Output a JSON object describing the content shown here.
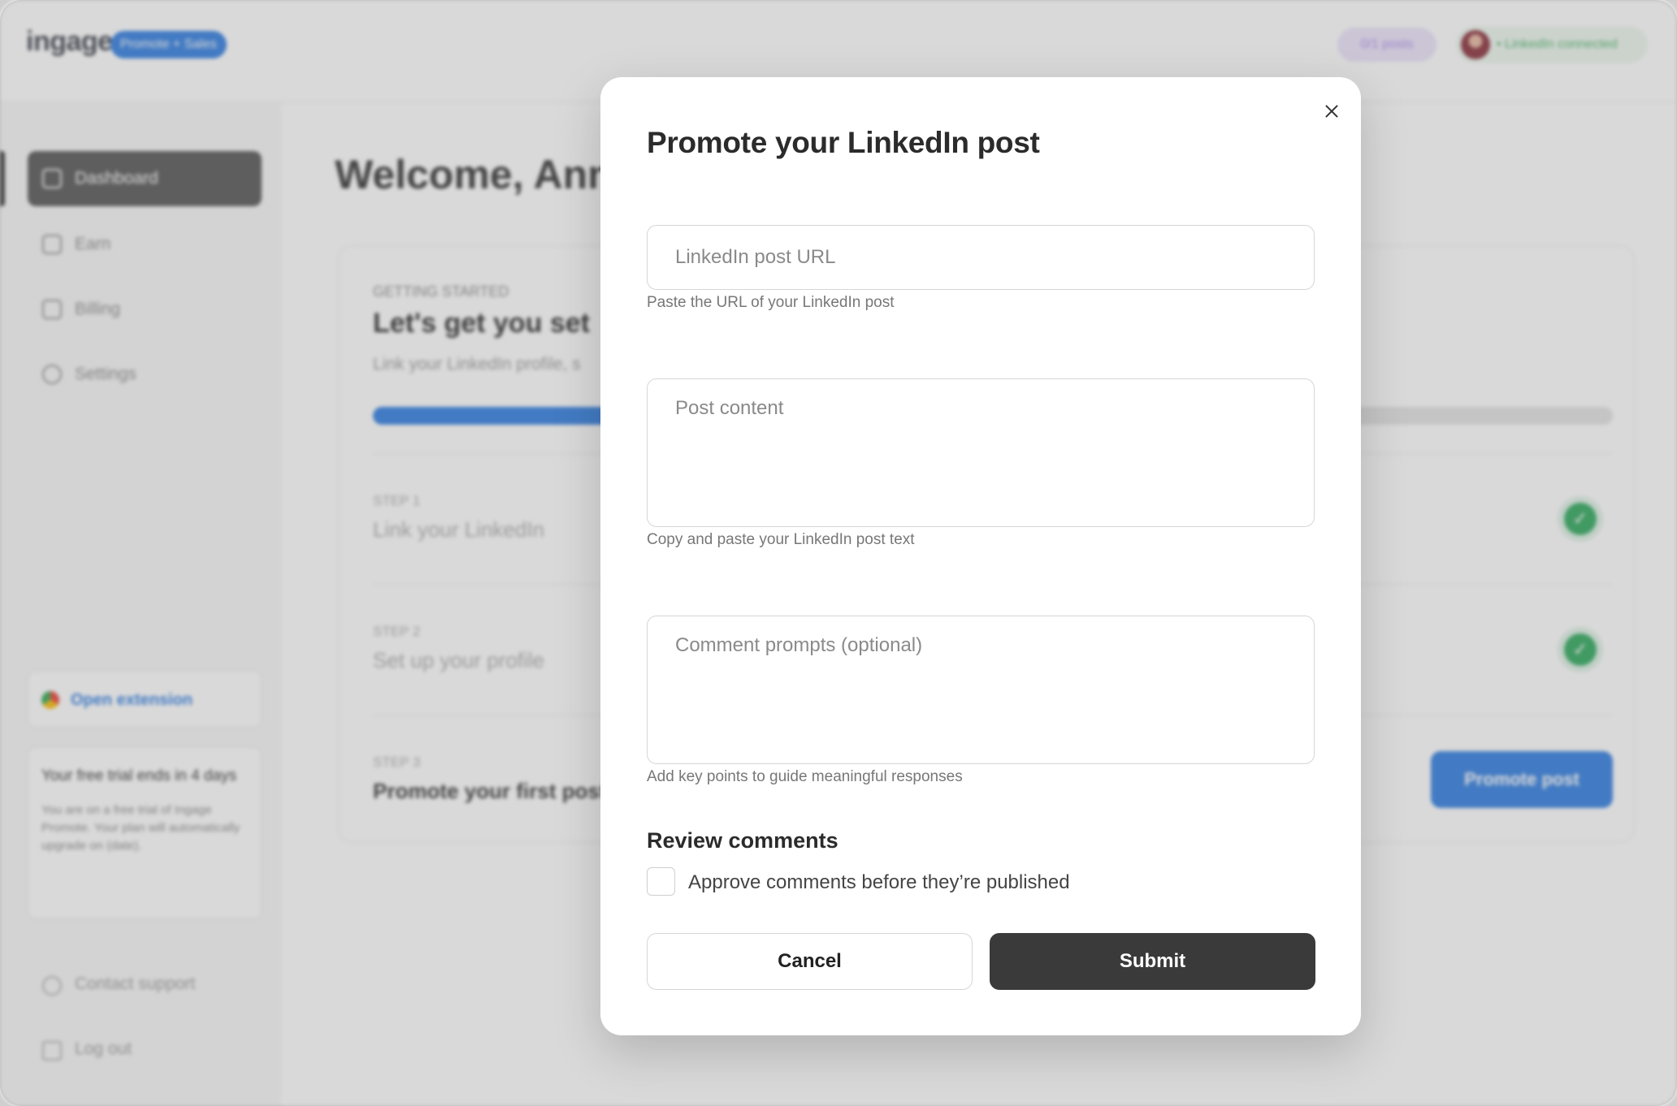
{
  "app": {
    "logo": "ingage",
    "badge": "Promote + Sales",
    "posts_pill": "0/1 posts",
    "connected": "• LinkedIn connected"
  },
  "sidebar": {
    "items": [
      {
        "label": "Dashboard",
        "icon": "home-icon"
      },
      {
        "label": "Earn",
        "icon": "earn-icon"
      },
      {
        "label": "Billing",
        "icon": "billing-icon"
      },
      {
        "label": "Settings",
        "icon": "gear-icon"
      }
    ],
    "extension": "Open extension",
    "trial_title": "Your free trial ends in 4 days",
    "trial_text": "You are on a free trial of Ingage Promote. Your plan will automatically upgrade on (date).",
    "contact": "Contact support",
    "logout": "Log out"
  },
  "main": {
    "welcome": "Welcome, Anna",
    "eyebrow": "GETTING STARTED",
    "card_title": "Let's get you set",
    "card_sub": "Link your LinkedIn profile, s",
    "progress": 0.66,
    "steps": [
      {
        "label": "STEP 1",
        "title": "Link your LinkedIn",
        "done": true
      },
      {
        "label": "STEP 2",
        "title": "Set up your profile",
        "done": true
      },
      {
        "label": "STEP 3",
        "title": "Promote your first post",
        "done": false
      }
    ],
    "promote_button": "Promote post"
  },
  "modal": {
    "title": "Promote your LinkedIn post",
    "url": {
      "placeholder": "LinkedIn post URL",
      "value": "",
      "hint": "Paste the URL of your LinkedIn post"
    },
    "content": {
      "placeholder": "Post content",
      "value": "",
      "hint": "Copy and paste your LinkedIn post text"
    },
    "prompts": {
      "placeholder": "Comment prompts (optional)",
      "value": "",
      "hint": "Add key points to guide meaningful responses"
    },
    "review_title": "Review comments",
    "approve_label": "Approve comments before they’re published",
    "approve_checked": false,
    "cancel": "Cancel",
    "submit": "Submit"
  },
  "colors": {
    "accent": "#2f7de1",
    "dark_button": "#3a3a3a",
    "success": "#2ea85c"
  }
}
